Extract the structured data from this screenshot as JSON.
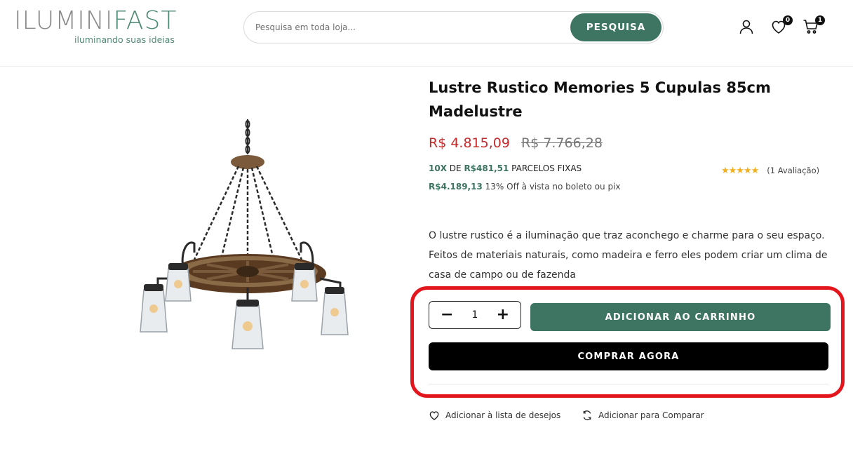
{
  "header": {
    "logo_part1": "ILUMINI",
    "logo_part2": "FAST",
    "logo_tagline": "iluminando suas ideias",
    "search_placeholder": "Pesquisa em toda loja...",
    "search_button": "PESQUISA",
    "wishlist_count": "0",
    "cart_count": "1"
  },
  "product": {
    "title": "Lustre Rustico Memories 5 Cupulas 85cm Madelustre",
    "price_new": "R$ 4.815,09",
    "price_old": "R$ 7.766,28",
    "installments_count": "10X",
    "installments_of": "DE",
    "installments_value": "R$481,51",
    "installments_suffix": "PARCELOS FIXAS",
    "cash_price": "R$4.189,13",
    "cash_note": "13% Off à vista no boleto ou pix",
    "rating_stars": "★★★★★",
    "rating_text": "(1 Avaliação)",
    "description": "O lustre rustico é a iluminação que traz aconchego e charme para o seu espaço. Feitos de materiais naturais, como madeira e ferro eles podem criar um clima de casa de campo ou de fazenda"
  },
  "purchase": {
    "quantity": "1",
    "minus": "−",
    "plus": "+",
    "add_to_cart": "ADICIONAR AO CARRINHO",
    "buy_now": "COMPRAR AGORA"
  },
  "links": {
    "wishlist": "Adicionar à lista de desejos",
    "compare": "Adicionar para Comparar"
  },
  "colors": {
    "brand_green": "#3d7462",
    "price_red": "#c52b2b",
    "highlight_red": "#e3161e",
    "star_yellow": "#f2b01e"
  },
  "icons": [
    "user-icon",
    "heart-icon",
    "cart-icon",
    "compare-icon"
  ]
}
